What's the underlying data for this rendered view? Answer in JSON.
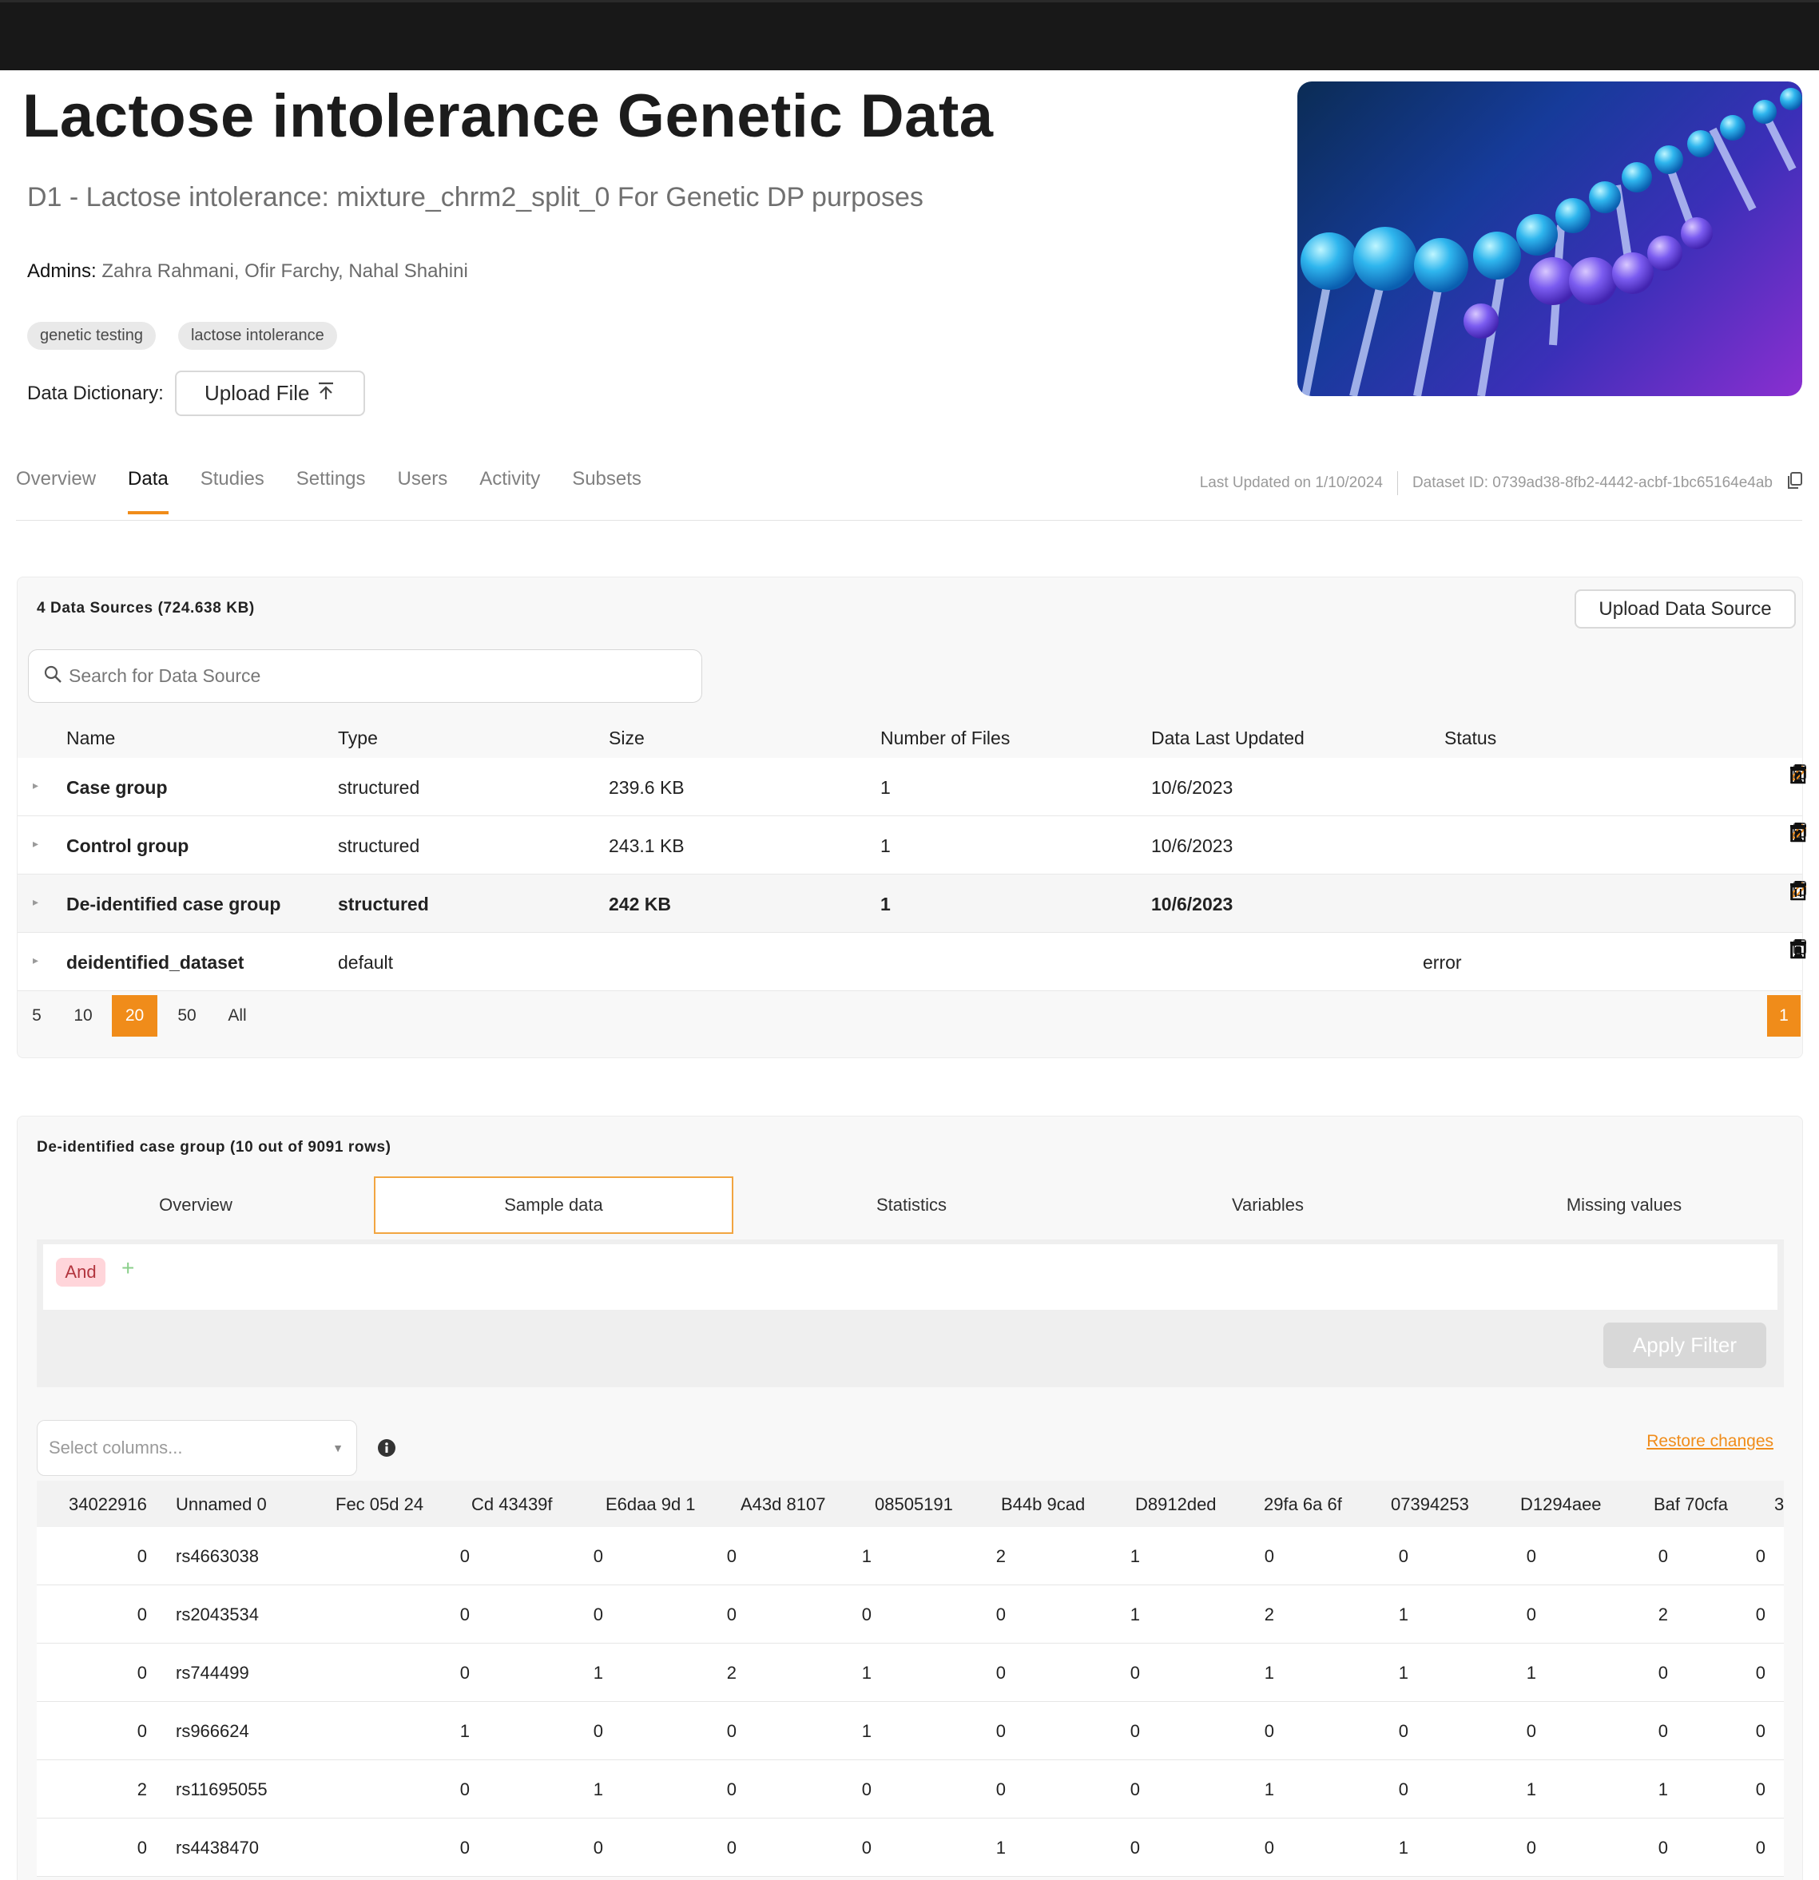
{
  "header": {
    "title": "Lactose intolerance Genetic Data",
    "subtitle": "D1 - Lactose intolerance: mixture_chrm2_split_0 For Genetic DP purposes",
    "admins_label": "Admins:",
    "admins": "Zahra Rahmani, Ofir Farchy, Nahal Shahini",
    "tags": [
      "genetic testing",
      "lactose intolerance"
    ],
    "data_dictionary_label": "Data Dictionary:",
    "upload_file_label": "Upload File"
  },
  "tabs": [
    "Overview",
    "Data",
    "Studies",
    "Settings",
    "Users",
    "Activity",
    "Subsets"
  ],
  "active_tab": "Data",
  "meta": {
    "last_updated": "Last Updated on 1/10/2024",
    "dataset_id": "Dataset ID: 0739ad38-8fb2-4442-acbf-1bc65164e4ab"
  },
  "data_sources": {
    "title": "4 Data Sources (724.638 KB)",
    "upload_label": "Upload Data Source",
    "search_placeholder": "Search for Data Source",
    "columns": [
      "Name",
      "Type",
      "Size",
      "Number of Files",
      "Data Last Updated",
      "Status"
    ],
    "rows": [
      {
        "name": "Case group",
        "type": "structured",
        "size": "239.6 KB",
        "files": "1",
        "updated": "10/6/2023",
        "status": ""
      },
      {
        "name": "Control group",
        "type": "structured",
        "size": "243.1 KB",
        "files": "1",
        "updated": "10/6/2023",
        "status": ""
      },
      {
        "name": "De-identified case group",
        "type": "structured",
        "size": "242 KB",
        "files": "1",
        "updated": "10/6/2023",
        "status": ""
      },
      {
        "name": "deidentified_dataset",
        "type": "default",
        "size": "",
        "files": "",
        "updated": "",
        "status": "error"
      }
    ],
    "page_sizes": [
      "5",
      "10",
      "20",
      "50",
      "All"
    ],
    "selected_page_size": "20",
    "current_page": "1"
  },
  "preview": {
    "title": "De-identified case group (10 out of 9091 rows)",
    "tabs": [
      "Overview",
      "Sample data",
      "Statistics",
      "Variables",
      "Missing values"
    ],
    "active_tab": "Sample data",
    "and_label": "And",
    "plus_label": "+",
    "apply_label": "Apply Filter",
    "select_columns_placeholder": "Select columns...",
    "restore_label": "Restore changes",
    "columns": [
      "34022916",
      "Unnamed 0",
      "Fec 05d 24",
      "Cd 43439f",
      "E6daa 9d 1",
      "A43d 8107",
      "08505191",
      "B44b 9cad",
      "D8912ded",
      "29fa 6a 6f",
      "07394253",
      "D1294aee",
      "Baf 70cfa",
      "3"
    ],
    "rows": [
      [
        "0",
        "rs4663038",
        "0",
        "0",
        "0",
        "1",
        "2",
        "1",
        "0",
        "0",
        "0",
        "0",
        "0"
      ],
      [
        "0",
        "rs2043534",
        "0",
        "0",
        "0",
        "0",
        "0",
        "1",
        "2",
        "1",
        "0",
        "2",
        "0"
      ],
      [
        "0",
        "rs744499",
        "0",
        "1",
        "2",
        "1",
        "0",
        "0",
        "1",
        "1",
        "1",
        "0",
        "0"
      ],
      [
        "0",
        "rs966624",
        "1",
        "0",
        "0",
        "1",
        "0",
        "0",
        "0",
        "0",
        "0",
        "0",
        "0"
      ],
      [
        "2",
        "rs11695055",
        "0",
        "1",
        "0",
        "0",
        "0",
        "0",
        "1",
        "0",
        "1",
        "1",
        "0"
      ],
      [
        "0",
        "rs4438470",
        "0",
        "0",
        "0",
        "0",
        "1",
        "0",
        "0",
        "1",
        "0",
        "0",
        "0"
      ]
    ]
  },
  "colors": {
    "accent": "#f08c1a",
    "topbar": "#181818",
    "chip_bg": "#ffd5da",
    "chip_text": "#b2343d"
  }
}
